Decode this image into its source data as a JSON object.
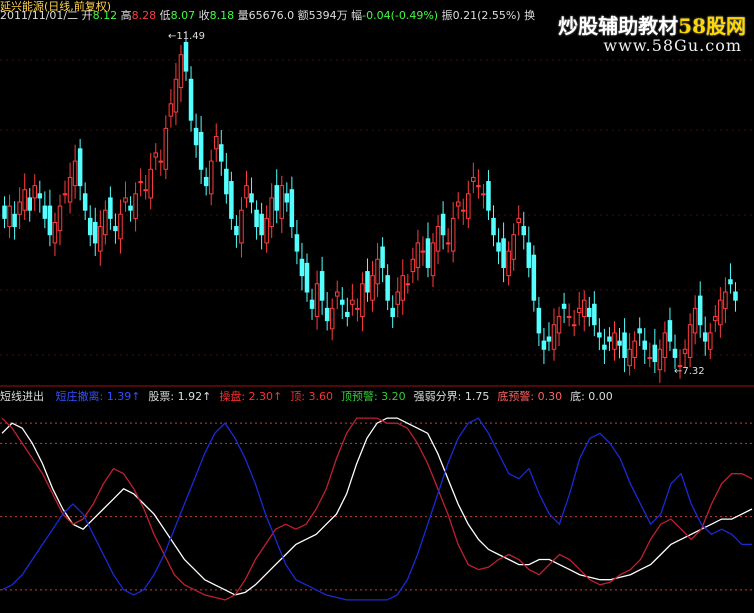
{
  "header": {
    "title": "延兴能源(日线,前复权)",
    "date": "2011/11/01/二",
    "open_label": "开",
    "open": "8.12",
    "high_label": "高",
    "high": "8.28",
    "low_label": "低",
    "low": "8.07",
    "close_label": "收",
    "close": "8.18",
    "vol_label": "量",
    "vol": "65676.0",
    "amount_label": "额",
    "amount": "5394万",
    "chg_label": "幅",
    "chg": "-0.04(-0.49%)",
    "amp_label": "振",
    "amp": "0.21(2.55%)",
    "extra": "换"
  },
  "watermark": {
    "text_a": "炒股辅助教材",
    "text_b": "58股网",
    "url": "www.58Gu.com"
  },
  "price_labels": {
    "high_mark": "11.49",
    "low_mark": "7.32"
  },
  "indicator": {
    "name": "短线进出",
    "items": [
      {
        "label": "短庄撤离:",
        "value": "1.39",
        "arrow": "↑",
        "color": "#3050ff"
      },
      {
        "label": "股票:",
        "value": "1.92",
        "arrow": "↑",
        "color": "#dddddd"
      },
      {
        "label": "操盘:",
        "value": "2.30",
        "arrow": "↑",
        "color": "#ff3030"
      },
      {
        "label": "顶:",
        "value": "3.60",
        "arrow": "",
        "color": "#ff3030"
      },
      {
        "label": "顶预警:",
        "value": "3.20",
        "arrow": "",
        "color": "#30d030"
      },
      {
        "label": "强弱分界:",
        "value": "1.75",
        "arrow": "",
        "color": "#dddddd"
      },
      {
        "label": "底预警:",
        "value": "0.30",
        "arrow": "",
        "color": "#ff6060"
      },
      {
        "label": "底:",
        "value": "0.00",
        "arrow": "",
        "color": "#dddddd"
      }
    ]
  },
  "colors": {
    "up": "#ff3c3c",
    "down": "#54ffff",
    "red_line": "#c02030",
    "white_line": "#ffffff",
    "blue_line": "#1a2ad8",
    "divider": "#a01010",
    "dash": "#c04040"
  },
  "chart_data": {
    "type": "candlestick",
    "price_closes": [
      9.2,
      9.35,
      9.1,
      9.4,
      9.55,
      9.3,
      9.6,
      9.45,
      9.2,
      9.0,
      9.15,
      9.35,
      9.5,
      9.7,
      9.9,
      9.6,
      9.3,
      9.0,
      8.9,
      9.1,
      9.3,
      9.2,
      9.05,
      9.25,
      9.45,
      9.3,
      9.5,
      9.65,
      9.55,
      9.8,
      10.0,
      9.9,
      10.3,
      10.6,
      10.9,
      11.2,
      11.0,
      10.4,
      10.1,
      9.8,
      9.6,
      9.9,
      10.2,
      9.9,
      9.5,
      9.2,
      9.0,
      9.3,
      9.6,
      9.4,
      9.1,
      9.0,
      9.2,
      9.45,
      9.3,
      9.6,
      9.4,
      9.1,
      8.8,
      8.5,
      8.3,
      8.1,
      8.4,
      8.2,
      7.95,
      8.1,
      8.3,
      8.15,
      8.0,
      8.2,
      8.1,
      8.4,
      8.3,
      8.5,
      8.7,
      8.6,
      8.2,
      8.0,
      8.3,
      8.5,
      8.4,
      8.7,
      8.9,
      8.8,
      8.6,
      8.9,
      9.1,
      9.0,
      8.9,
      9.2,
      9.4,
      9.3,
      9.5,
      9.7,
      9.6,
      9.5,
      9.3,
      9.0,
      8.8,
      8.6,
      8.8,
      9.0,
      9.2,
      9.0,
      8.6,
      8.2,
      7.8,
      7.6,
      7.7,
      7.9,
      8.0,
      8.1,
      8.0,
      7.9,
      8.1,
      8.2,
      8.0,
      7.9,
      7.75,
      7.6,
      7.7,
      7.8,
      7.65,
      7.5,
      7.6,
      7.7,
      7.8,
      7.6,
      7.5,
      7.45,
      7.6,
      7.8,
      7.7,
      7.5,
      7.4,
      7.6,
      7.9,
      8.1,
      7.9,
      7.7,
      7.8,
      8.0,
      8.2,
      8.3,
      8.4,
      8.2
    ],
    "high_point": 11.49,
    "low_point": 7.32,
    "series": [
      {
        "name": "股票",
        "values": [
          3.4,
          3.6,
          3.5,
          3.2,
          2.8,
          2.3,
          1.9,
          1.6,
          1.5,
          1.7,
          1.9,
          2.1,
          2.3,
          2.2,
          2.0,
          1.8,
          1.5,
          1.2,
          0.9,
          0.7,
          0.5,
          0.4,
          0.3,
          0.2,
          0.25,
          0.4,
          0.6,
          0.8,
          1.0,
          1.2,
          1.3,
          1.4,
          1.6,
          1.8,
          2.2,
          2.8,
          3.3,
          3.6,
          3.7,
          3.7,
          3.6,
          3.5,
          3.4,
          3.0,
          2.5,
          2.0,
          1.6,
          1.3,
          1.1,
          1.0,
          0.9,
          0.8,
          0.8,
          0.9,
          0.9,
          0.8,
          0.7,
          0.6,
          0.55,
          0.5,
          0.5,
          0.55,
          0.6,
          0.7,
          0.8,
          1.0,
          1.2,
          1.3,
          1.4,
          1.5,
          1.6,
          1.7,
          1.7,
          1.8,
          1.9
        ]
      },
      {
        "name": "操盘",
        "values": [
          3.7,
          3.5,
          3.2,
          2.9,
          2.6,
          2.2,
          1.8,
          1.6,
          1.7,
          2.0,
          2.4,
          2.7,
          2.6,
          2.3,
          1.9,
          1.4,
          1.0,
          0.6,
          0.4,
          0.3,
          0.2,
          0.15,
          0.1,
          0.2,
          0.5,
          0.9,
          1.2,
          1.5,
          1.6,
          1.5,
          1.6,
          1.9,
          2.3,
          2.9,
          3.4,
          3.7,
          3.7,
          3.7,
          3.6,
          3.6,
          3.5,
          3.2,
          2.8,
          2.3,
          1.8,
          1.2,
          0.8,
          0.7,
          0.75,
          0.9,
          1.0,
          0.9,
          0.7,
          0.6,
          0.8,
          1.0,
          0.9,
          0.7,
          0.5,
          0.4,
          0.45,
          0.6,
          0.7,
          0.9,
          1.3,
          1.6,
          1.7,
          1.5,
          1.3,
          1.5,
          2.0,
          2.4,
          2.6,
          2.6,
          2.5
        ]
      },
      {
        "name": "短庄撤离",
        "values": [
          0.3,
          0.4,
          0.6,
          0.9,
          1.2,
          1.5,
          1.8,
          2.0,
          1.8,
          1.4,
          1.0,
          0.6,
          0.3,
          0.2,
          0.3,
          0.6,
          1.0,
          1.5,
          2.0,
          2.5,
          3.0,
          3.4,
          3.6,
          3.3,
          2.9,
          2.4,
          1.8,
          1.3,
          0.8,
          0.5,
          0.4,
          0.3,
          0.2,
          0.15,
          0.1,
          0.1,
          0.1,
          0.1,
          0.1,
          0.2,
          0.5,
          1.0,
          1.6,
          2.2,
          2.8,
          3.3,
          3.6,
          3.7,
          3.4,
          3.0,
          2.6,
          2.5,
          2.7,
          2.2,
          1.8,
          1.6,
          2.2,
          2.9,
          3.3,
          3.4,
          3.2,
          2.9,
          2.4,
          2.0,
          1.6,
          1.8,
          2.4,
          2.6,
          2.0,
          1.6,
          1.4,
          1.5,
          1.4,
          1.2,
          1.2
        ]
      }
    ],
    "ref_lines": [
      3.6,
      3.2,
      1.75,
      0.3,
      0.0
    ]
  }
}
